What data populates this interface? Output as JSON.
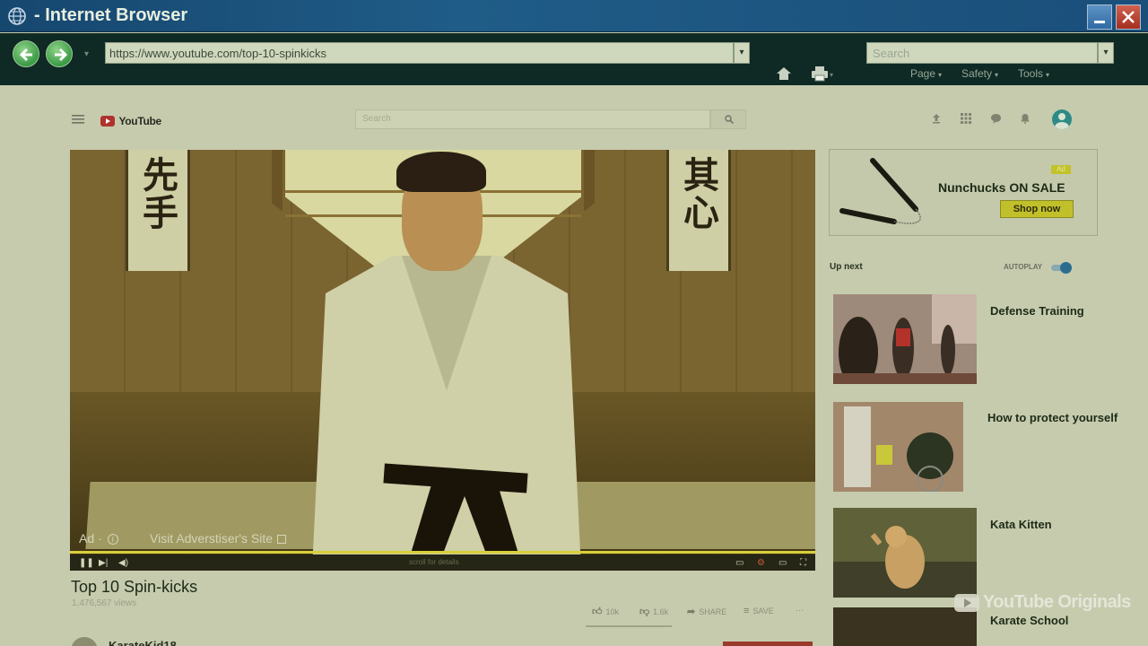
{
  "browser": {
    "title": "- Internet Browser",
    "url": "https://www.youtube.com/top-10-spinkicks",
    "search_placeholder": "Search",
    "menu": [
      "Page",
      "Safety",
      "Tools"
    ]
  },
  "youtube": {
    "logo": "YouTube",
    "search_placeholder": "Search",
    "video": {
      "scroll_left_text": "先手",
      "scroll_right_text": "其心",
      "ad_label": "Ad ·",
      "visit_link": "Visit Adverstiser's Site",
      "scroll_hint": "scroll for details",
      "progress_fraction": 1.0,
      "title": "Top 10 Spin-kicks",
      "views": "1,476,567 views",
      "likes": "10k",
      "dislikes": "1.6k",
      "share": "SHARE",
      "save": "SAVE",
      "more": "···"
    },
    "channel": {
      "name": "KarateKid18"
    },
    "ad_card": {
      "badge": "Ad",
      "title": "Nunchucks ON SALE",
      "button": "Shop now"
    },
    "up_next_label": "Up next",
    "autoplay_label": "AUTOPLAY",
    "up_next": [
      {
        "title": "Defense Training"
      },
      {
        "title": "How to protect yourself"
      },
      {
        "title": "Kata Kitten"
      },
      {
        "title": "Karate School"
      }
    ],
    "watermark": "YouTube Originals"
  },
  "colors": {
    "titlebar": "#1f5c87",
    "toolbar": "#0f2a25",
    "page_tint": "#c6cbae",
    "shop_button": "#c2c02a",
    "progress": "#d8cf3a"
  }
}
